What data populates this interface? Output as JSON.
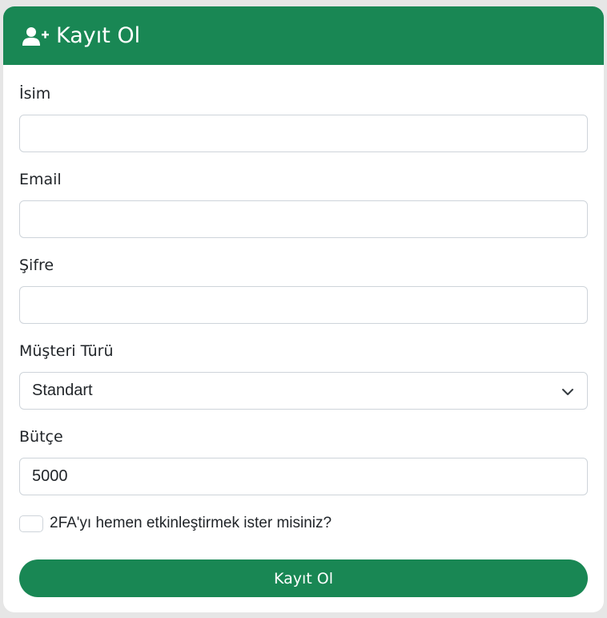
{
  "header": {
    "title": "Kayıt Ol",
    "icon": "user-plus-icon"
  },
  "form": {
    "name_label": "İsim",
    "name_value": "",
    "email_label": "Email",
    "email_value": "",
    "password_label": "Şifre",
    "password_value": "",
    "customer_type_label": "Müşteri Türü",
    "customer_type_selected": "Standart",
    "budget_label": "Bütçe",
    "budget_value": "5000",
    "twofa_label": "2FA'yı hemen etkinleştirmek ister misiniz?",
    "twofa_checked": false,
    "submit_label": "Kayıt Ol"
  },
  "colors": {
    "accent": "#198754",
    "background": "#e6e6e6"
  }
}
